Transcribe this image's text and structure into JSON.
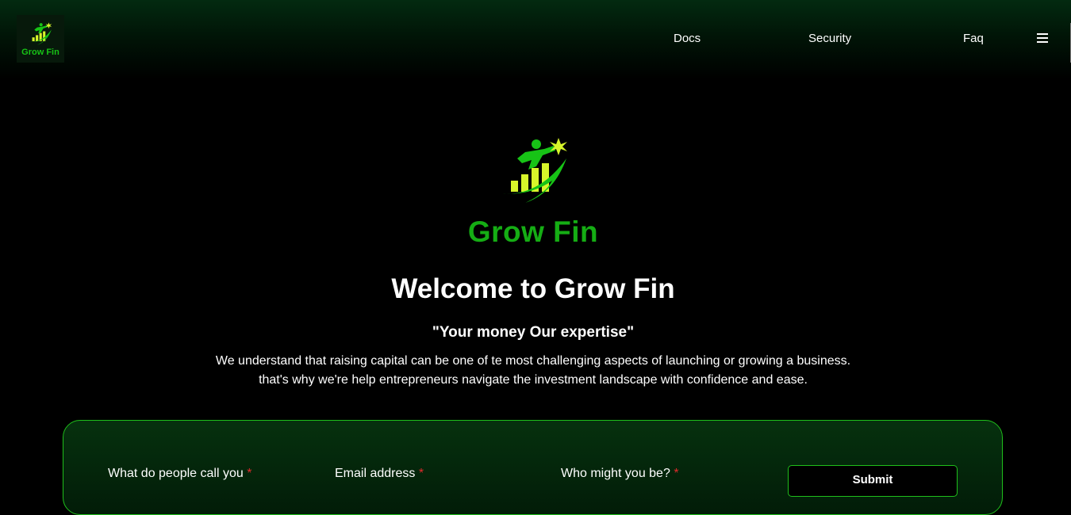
{
  "header": {
    "brand_text": "Grow Fin",
    "nav": [
      {
        "label": "Docs"
      },
      {
        "label": "Security"
      },
      {
        "label": "Faq"
      }
    ],
    "menu_icon": "hamburger-menu-icon"
  },
  "hero": {
    "logo_text": "Grow Fin",
    "title": "Welcome to Grow Fin",
    "tagline": "\"Your money Our expertise\"",
    "description_line1": "We understand that raising capital can be one of te most challenging aspects of launching or growing a business.",
    "description_line2": "that's why we're help entrepreneurs navigate the investment landscape with confidence and ease."
  },
  "form": {
    "name_label": "What do people call you",
    "email_label": "Email address",
    "role_label": "Who might you be?",
    "required_mark": "*",
    "submit_label": "Submit"
  },
  "colors": {
    "accent_green": "#15ad14",
    "logo_lime": "#d8f52a",
    "required_red": "#e02b2b",
    "border_green": "#1fbf1b"
  }
}
